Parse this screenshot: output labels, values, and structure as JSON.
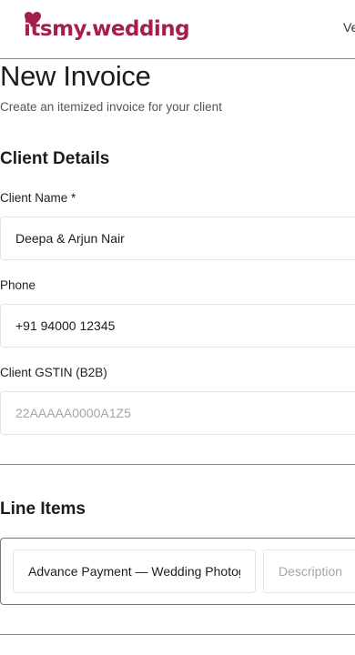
{
  "brand": {
    "logo_text": "itsmy.wedding",
    "logo_color": "#a51f4e"
  },
  "header": {
    "nav_link_partial": "Ve"
  },
  "page": {
    "title": "New Invoice",
    "subtitle": "Create an itemized invoice for your client"
  },
  "client_details": {
    "section_title": "Client Details",
    "client_name": {
      "label": "Client Name *",
      "value": "Deepa & Arjun Nair"
    },
    "phone": {
      "label": "Phone",
      "value": "+91 94000 12345"
    },
    "gstin": {
      "label": "Client GSTIN (B2B)",
      "value": "",
      "placeholder": "22AAAAA0000A1Z5"
    }
  },
  "line_items": {
    "section_title": "Line Items",
    "items": [
      {
        "item_value": "Advance Payment — Wedding Photography",
        "description_value": "",
        "description_placeholder": "Description"
      }
    ]
  }
}
